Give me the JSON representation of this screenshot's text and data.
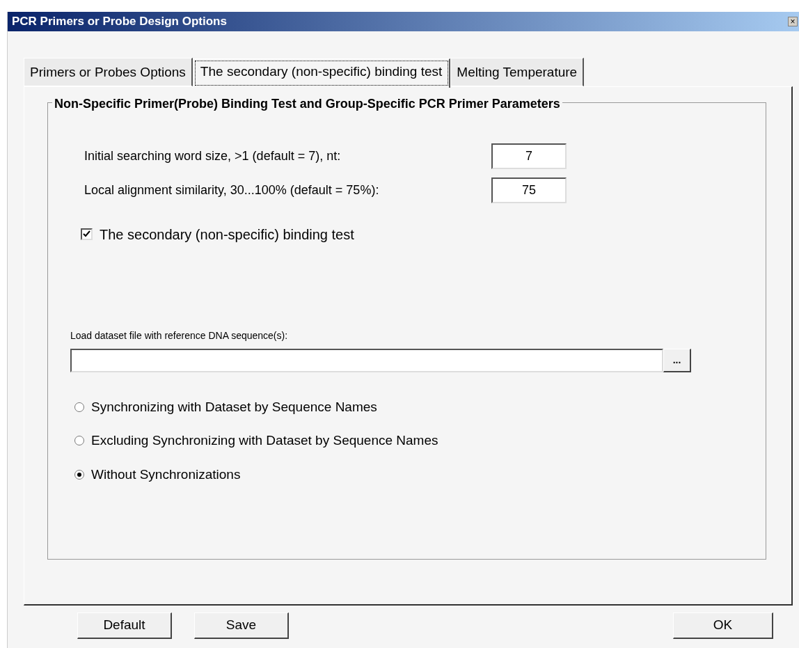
{
  "window": {
    "title": "PCR Primers or Probe Design Options",
    "close": "×"
  },
  "tabs": [
    {
      "label": "Primers or Probes Options",
      "selected": false
    },
    {
      "label": "The secondary (non-specific) binding test",
      "selected": true
    },
    {
      "label": "Melting Temperature",
      "selected": false
    }
  ],
  "group": {
    "title": "Non-Specific Primer(Probe) Binding Test and Group-Specific PCR Primer Parameters",
    "fields": [
      {
        "label": "Initial searching word size, >1 (default = 7), nt:",
        "value": "7"
      },
      {
        "label": "Local alignment similarity, 30...100% (default = 75%):",
        "value": "75"
      }
    ],
    "checkbox": {
      "label": "The secondary (non-specific) binding test",
      "checked": true
    },
    "file": {
      "label": "Load dataset file with reference DNA sequence(s):",
      "browse": "..."
    },
    "radios": [
      {
        "label": "Synchronizing with Dataset by Sequence Names",
        "selected": false
      },
      {
        "label": "Excluding Synchronizing with Dataset by Sequence Names",
        "selected": false
      },
      {
        "label": "Without Synchronizations",
        "selected": true
      }
    ]
  },
  "buttons": [
    {
      "label": "Default",
      "kind": "left"
    },
    {
      "label": "Save",
      "kind": "left"
    },
    {
      "label": "OK",
      "kind": "right"
    }
  ]
}
